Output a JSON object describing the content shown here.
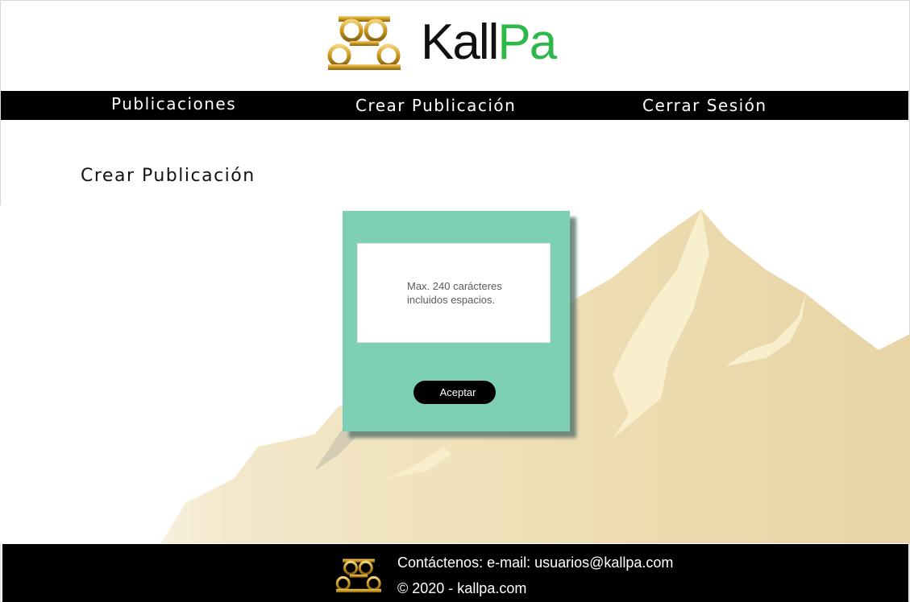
{
  "brand": {
    "logo_text_part1": "Kall",
    "logo_text_part2": "Pa",
    "logo_icon": "kallpa-gold-rings-icon",
    "colors": {
      "gold": "#c9961a",
      "green": "#2fb84a",
      "dark": "#111111"
    }
  },
  "nav": {
    "items": [
      {
        "label": "Publicaciones"
      },
      {
        "label": "Crear Publicación"
      },
      {
        "label": "Cerrar Sesión"
      }
    ],
    "background": "#000000"
  },
  "main": {
    "title": "Crear Publicación",
    "form": {
      "textarea_placeholder": "Max. 240 carácteres incluidos espacios.",
      "textarea_value": "",
      "submit_label": "Aceptar",
      "card_color": "#7dcfb6"
    }
  },
  "footer": {
    "contact_text": "Contáctenos: e-mail: usuarios@kallpa.com",
    "copyright_text": "© 2020 - kallpa.com",
    "logo_icon": "kallpa-gold-rings-icon"
  }
}
